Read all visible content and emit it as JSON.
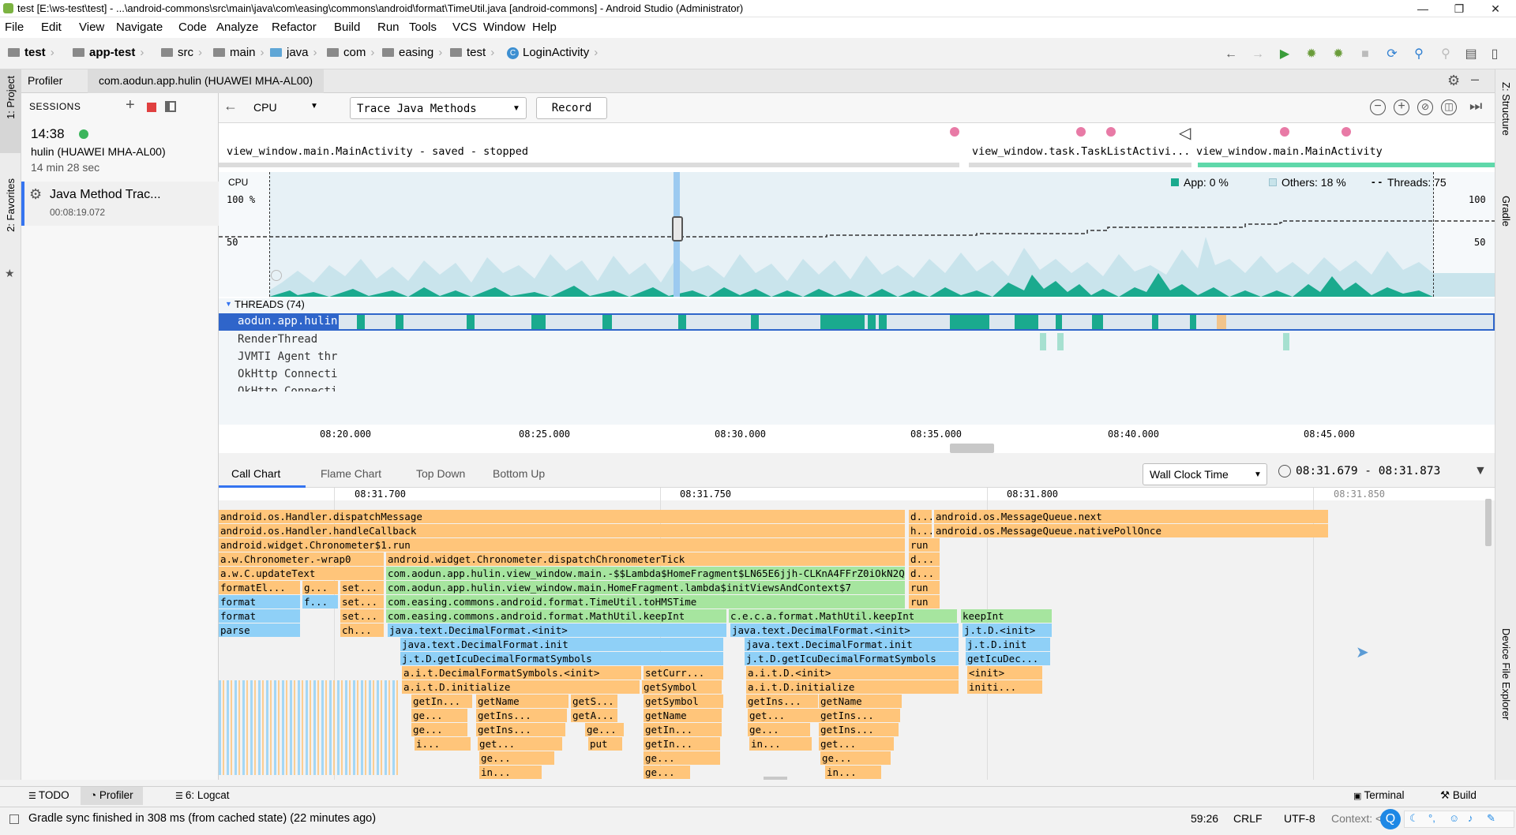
{
  "window": {
    "title": "test [E:\\ws-test\\test] - ...\\android-commons\\src\\main\\java\\com\\easing\\commons\\android\\format\\TimeUtil.java [android-commons] - Android Studio (Administrator)",
    "minimize": "—",
    "restore": "❐",
    "close": "✕"
  },
  "menu": [
    "File",
    "Edit",
    "View",
    "Navigate",
    "Code",
    "Analyze",
    "Refactor",
    "Build",
    "Run",
    "Tools",
    "VCS",
    "Window",
    "Help"
  ],
  "breadcrumbs": [
    "test",
    "app-test",
    "src",
    "main",
    "java",
    "com",
    "easing",
    "test",
    "LoginActivity"
  ],
  "left_strip": {
    "project": "1: Project",
    "favorites": "2: Favorites"
  },
  "right_strip": {
    "structure": "Z: Structure",
    "gradle": "Gradle",
    "device": "Device File Explorer"
  },
  "profiler_tabs": {
    "profiler": "Profiler",
    "session": "com.aodun.app.hulin (HUAWEI MHA-AL00)"
  },
  "sessions": {
    "header": "SESSIONS",
    "time": "14:38",
    "device": "hulin (HUAWEI MHA-AL00)",
    "duration": "14 min 28 sec",
    "trace_name": "Java Method Trac...",
    "trace_time": "00:08:19.072"
  },
  "toolbar": {
    "monitor": "CPU",
    "config": "Trace Java Methods",
    "record": "Record"
  },
  "activities": [
    {
      "label": "view_window.main.MainActivity - saved - stopped"
    },
    {
      "label": "view_window.task.TaskListActivi..."
    },
    {
      "label": "view_window.main.MainActivity"
    }
  ],
  "cpu": {
    "label": "CPU",
    "y_top_left": "100 %",
    "y_mid_left": "50",
    "y_top_right": "100",
    "y_mid_right": "50",
    "legend_app": "App: 0 %",
    "legend_others": "Others: 18 %",
    "legend_threads": "Threads: 75",
    "app_color": "#1aaa8e",
    "others_color": "#c7e3ea"
  },
  "threads": {
    "header": "THREADS (74)",
    "rows": [
      "aodun.app.hulin",
      "RenderThread",
      "JVMTI Agent thr",
      "OkHttp Connecti",
      "OkHttp Connecti"
    ]
  },
  "time_axis": [
    "08:20.000",
    "08:25.000",
    "08:30.000",
    "08:35.000",
    "08:40.000",
    "08:45.000"
  ],
  "analysis_tabs": [
    "Call Chart",
    "Flame Chart",
    "Top Down",
    "Bottom Up"
  ],
  "clock": {
    "mode": "Wall Clock Time",
    "range": "08:31.679 - 08:31.873"
  },
  "chart_axis": [
    "08:31.700",
    "08:31.750",
    "08:31.800",
    "08:31.850"
  ],
  "frames": [
    {
      "t": "android.os.Handler.dispatchMessage",
      "c": "o"
    },
    {
      "t": "d...",
      "c": "o"
    },
    {
      "t": "android.os.MessageQueue.next",
      "c": "o"
    },
    {
      "t": "android.os.Handler.handleCallback",
      "c": "o"
    },
    {
      "t": "h...",
      "c": "o"
    },
    {
      "t": "android.os.MessageQueue.nativePollOnce",
      "c": "o"
    },
    {
      "t": "android.widget.Chronometer$1.run",
      "c": "o"
    },
    {
      "t": "run",
      "c": "o"
    },
    {
      "t": "a.w.Chronometer.-wrap0",
      "c": "o"
    },
    {
      "t": "android.widget.Chronometer.dispatchChronometerTick",
      "c": "o"
    },
    {
      "t": "d...",
      "c": "o"
    },
    {
      "t": "a.w.C.updateText",
      "c": "o"
    },
    {
      "t": "com.aodun.app.hulin.view_window.main.-$$Lambda$HomeFragment$LN65E6jjh-CLKnA4FFrZ0iOkN2Q.onChronometerTick",
      "c": "g"
    },
    {
      "t": "d...",
      "c": "o"
    },
    {
      "t": "formatEl...",
      "c": "o"
    },
    {
      "t": "g...",
      "c": "o"
    },
    {
      "t": "set...",
      "c": "o"
    },
    {
      "t": "com.aodun.app.hulin.view_window.main.HomeFragment.lambda$initViewsAndContext$7",
      "c": "g"
    },
    {
      "t": "run",
      "c": "o"
    },
    {
      "t": "format",
      "c": "b"
    },
    {
      "t": "f...",
      "c": "b"
    },
    {
      "t": "set...",
      "c": "o"
    },
    {
      "t": "com.easing.commons.android.format.TimeUtil.toHMSTime",
      "c": "g"
    },
    {
      "t": "run",
      "c": "o"
    },
    {
      "t": "format",
      "c": "b"
    },
    {
      "t": "set...",
      "c": "o"
    },
    {
      "t": "com.easing.commons.android.format.MathUtil.keepInt",
      "c": "g"
    },
    {
      "t": "c.e.c.a.format.MathUtil.keepInt",
      "c": "g"
    },
    {
      "t": "keepInt",
      "c": "g"
    },
    {
      "t": "parse",
      "c": "b"
    },
    {
      "t": "ch...",
      "c": "o"
    },
    {
      "t": "java.text.DecimalFormat.<init>",
      "c": "b"
    },
    {
      "t": "java.text.DecimalFormat.<init>",
      "c": "b"
    },
    {
      "t": "j.t.D.<init>",
      "c": "b"
    },
    {
      "t": "java.text.DecimalFormat.init",
      "c": "b"
    },
    {
      "t": "java.text.DecimalFormat.init",
      "c": "b"
    },
    {
      "t": "j.t.D.init",
      "c": "b"
    },
    {
      "t": "j.t.D.getIcuDecimalFormatSymbols",
      "c": "b"
    },
    {
      "t": "j.t.D.getIcuDecimalFormatSymbols",
      "c": "b"
    },
    {
      "t": "getIcuDec...",
      "c": "b"
    },
    {
      "t": "a.i.t.DecimalFormatSymbols.<init>",
      "c": "o"
    },
    {
      "t": "setCurr...",
      "c": "o"
    },
    {
      "t": "a.i.t.D.<init>",
      "c": "o"
    },
    {
      "t": "<init>",
      "c": "o"
    },
    {
      "t": "a.i.t.D.initialize",
      "c": "o"
    },
    {
      "t": "getSymbol",
      "c": "o"
    },
    {
      "t": "a.i.t.D.initialize",
      "c": "o"
    },
    {
      "t": "initi...",
      "c": "o"
    },
    {
      "t": "getIn...",
      "c": "o"
    },
    {
      "t": "getName",
      "c": "o"
    },
    {
      "t": "getS...",
      "c": "o"
    },
    {
      "t": "getSymbol",
      "c": "o"
    },
    {
      "t": "getIns...",
      "c": "o"
    },
    {
      "t": "getName",
      "c": "o"
    },
    {
      "t": "ge...",
      "c": "o"
    },
    {
      "t": "getIns...",
      "c": "o"
    },
    {
      "t": "getA...",
      "c": "o"
    },
    {
      "t": "getName",
      "c": "o"
    },
    {
      "t": "get...",
      "c": "o"
    },
    {
      "t": "getIns...",
      "c": "o"
    },
    {
      "t": "ge...",
      "c": "o"
    },
    {
      "t": "getIns...",
      "c": "o"
    },
    {
      "t": "ge...",
      "c": "o"
    },
    {
      "t": "getIn...",
      "c": "o"
    },
    {
      "t": "ge...",
      "c": "o"
    },
    {
      "t": "getIns...",
      "c": "o"
    },
    {
      "t": "i...",
      "c": "o"
    },
    {
      "t": "get...",
      "c": "o"
    },
    {
      "t": "put",
      "c": "o"
    },
    {
      "t": "getIn...",
      "c": "o"
    },
    {
      "t": "in...",
      "c": "o"
    },
    {
      "t": "get...",
      "c": "o"
    },
    {
      "t": "ge...",
      "c": "o"
    },
    {
      "t": "ge...",
      "c": "o"
    },
    {
      "t": "ge...",
      "c": "o"
    },
    {
      "t": "in...",
      "c": "o"
    },
    {
      "t": "ge...",
      "c": "o"
    },
    {
      "t": "in...",
      "c": "o"
    }
  ],
  "bottom_tabs": [
    "TODO",
    "Profiler",
    "6: Logcat"
  ],
  "bottom_right_tabs": [
    "Terminal",
    "Build"
  ],
  "status": {
    "message": "Gradle sync finished in 308 ms (from cached state) (22 minutes ago)",
    "position": "59:26",
    "line_sep": "CRLF",
    "encoding": "UTF-8",
    "context": "Context: <no"
  }
}
